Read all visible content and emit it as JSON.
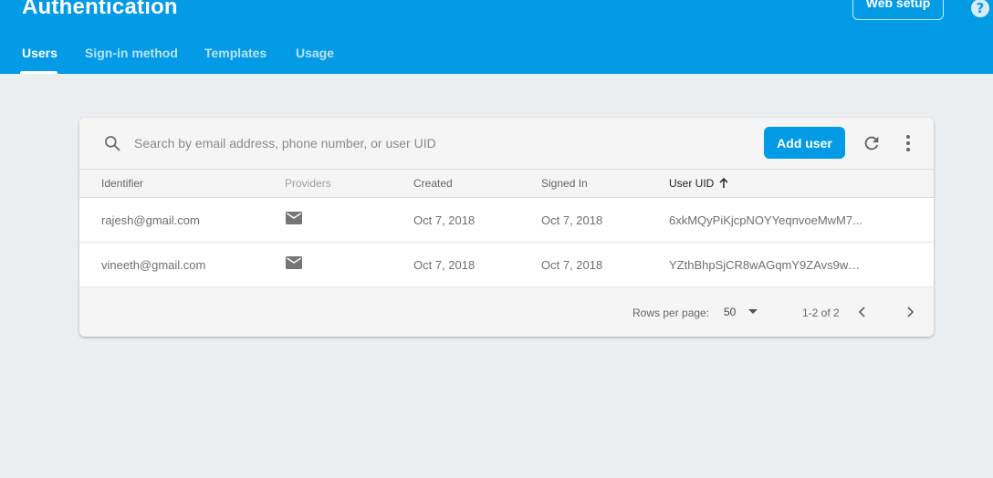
{
  "header": {
    "title": "Authentication",
    "web_setup_label": "Web setup",
    "help_glyph": "?",
    "tabs": [
      {
        "label": "Users",
        "active": true
      },
      {
        "label": "Sign-in method",
        "active": false
      },
      {
        "label": "Templates",
        "active": false
      },
      {
        "label": "Usage",
        "active": false
      }
    ]
  },
  "toolbar": {
    "search_placeholder": "Search by email address, phone number, or user UID",
    "add_user_label": "Add user",
    "icons": [
      "search-icon",
      "refresh-icon",
      "more-vert-icon"
    ]
  },
  "table": {
    "columns": [
      "Identifier",
      "Providers",
      "Created",
      "Signed In",
      "User UID"
    ],
    "sorted_column": "User UID",
    "sort_direction": "ascending",
    "rows": [
      {
        "identifier": "rajesh@gmail.com",
        "provider": "email-icon",
        "created": "Oct 7, 2018",
        "signed_in": "Oct 7, 2018",
        "uid": "6xkMQyPiKjcpNOYYeqnvoeMwM7..."
      },
      {
        "identifier": "vineeth@gmail.com",
        "provider": "email-icon",
        "created": "Oct 7, 2018",
        "signed_in": "Oct 7, 2018",
        "uid": "YZthBhpSjCR8wAGqmY9ZAvs9ww..."
      }
    ]
  },
  "pagination": {
    "rows_per_page_label": "Rows per page:",
    "rows_per_page_value": "50",
    "range_text": "1-2 of 2"
  },
  "colors": {
    "brand": "#039be5",
    "background": "#eceff1"
  }
}
